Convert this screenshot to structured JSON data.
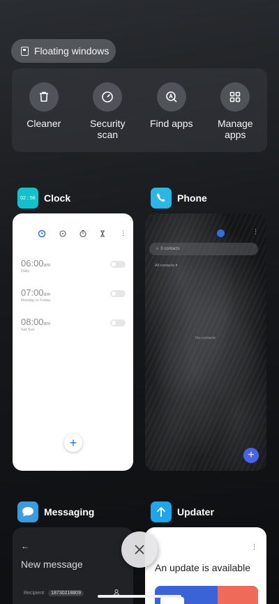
{
  "floating_windows": {
    "label": "Floating windows",
    "icon": "floating-window-icon"
  },
  "quick_actions": [
    {
      "label": "Cleaner",
      "icon": "trash-icon"
    },
    {
      "label": "Security\nscan",
      "icon": "security-gauge-icon"
    },
    {
      "label": "Find apps",
      "icon": "find-apps-icon"
    },
    {
      "label": "Manage\napps",
      "icon": "grid-icon"
    }
  ],
  "apps": {
    "clock": {
      "name": "Clock",
      "icon_text": "02 : 56",
      "icon_color": "#12c1c9",
      "alarms": [
        {
          "time": "06:00",
          "ampm": "am",
          "repeat": "Daily"
        },
        {
          "time": "07:00",
          "ampm": "am",
          "repeat": "Monday to Friday"
        },
        {
          "time": "08:00",
          "ampm": "am",
          "repeat": "Sat Sun"
        }
      ]
    },
    "phone": {
      "name": "Phone",
      "icon_color": "#2bb6e6",
      "search_placeholder": "0 contacts",
      "filter_label": "All contacts",
      "empty_text": "No contacts"
    },
    "messaging": {
      "name": "Messaging",
      "icon_color": "#3a9ce0",
      "title": "New message",
      "recipient_label": "Recipient",
      "recipient_value": "18730218809"
    },
    "updater": {
      "name": "Updater",
      "icon_color": "#1ea6e8",
      "headline": "An update is available"
    }
  },
  "colors": {
    "accent_blue": "#1a7bea",
    "phone_fab": "#4b63e6"
  }
}
